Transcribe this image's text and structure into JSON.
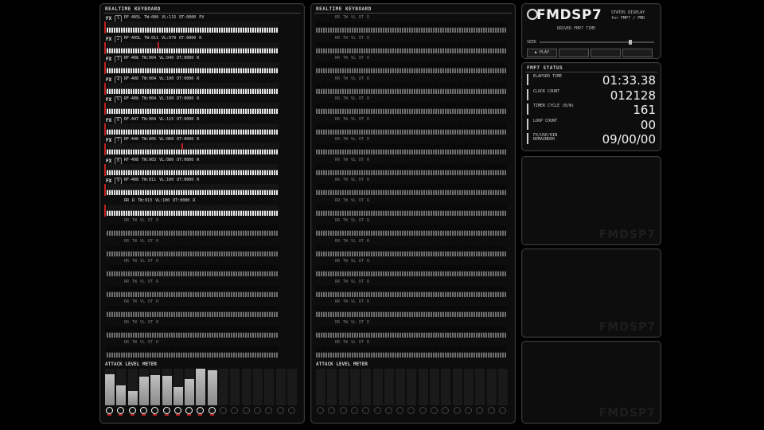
{
  "left_panel": {
    "header": "REALTIME KEYBOARD",
    "rows": [
      {
        "fx": "FX",
        "ch": "1",
        "info": "RF-405L TW:000 VL:115 DT:0000 PV",
        "active": true,
        "mark": false
      },
      {
        "fx": "FX",
        "ch": "2",
        "info": "RF-405L TW:011 VL:070 DT:0000 R",
        "active": true,
        "mark": true
      },
      {
        "fx": "FX",
        "ch": "3",
        "info": "RF-408 TW:004 VL:040 DT:0000 R",
        "active": true,
        "mark": false
      },
      {
        "fx": "FX",
        "ch": "4",
        "info": "RF-408 TW:004 VL:100 DT:0000 R",
        "active": true,
        "mark": false
      },
      {
        "fx": "FX",
        "ch": "5",
        "info": "RF-408 TW:004 VL:100 DT:0000 R",
        "active": true,
        "mark": false
      },
      {
        "fx": "FX",
        "ch": "6",
        "info": "RF-447 TW:004 VL:115 DT:0000 R",
        "active": true,
        "mark": false
      },
      {
        "fx": "FX",
        "ch": "7",
        "info": "RF-440 TW:005 VL:060 DT:0000 R",
        "active": true,
        "mark": true
      },
      {
        "fx": "FX",
        "ch": "8",
        "info": "RF-408 TW:003 VL:080 DT:0000 R",
        "active": true,
        "mark": false
      },
      {
        "fx": "FX",
        "ch": "9",
        "info": "RF-408 TW:011 VL:100 DT:0000 R",
        "active": true,
        "mark": false
      },
      {
        "fx": "",
        "ch": "",
        "info": "RR R TW:013 VL:100 DT:0000 R",
        "active": true,
        "mark": false
      },
      {
        "fx": "",
        "ch": "",
        "info": "RR TW VL DT R",
        "active": false,
        "mark": false
      },
      {
        "fx": "",
        "ch": "",
        "info": "RR TW VL DT R",
        "active": false,
        "mark": false
      },
      {
        "fx": "",
        "ch": "",
        "info": "RR TW VL DT R",
        "active": false,
        "mark": false
      },
      {
        "fx": "",
        "ch": "",
        "info": "RR TW VL DT R",
        "active": false,
        "mark": false
      },
      {
        "fx": "",
        "ch": "",
        "info": "RR TW VL DT R",
        "active": false,
        "mark": false
      },
      {
        "fx": "",
        "ch": "",
        "info": "RR TW VL DT R",
        "active": false,
        "mark": false
      },
      {
        "fx": "",
        "ch": "",
        "info": "RR TW VL DT R",
        "active": false,
        "mark": false
      }
    ],
    "meter_label": "ATTACK LEVEL METER",
    "meter_levels": [
      0.85,
      0.55,
      0.4,
      0.78,
      0.82,
      0.8,
      0.5,
      0.72,
      1.0,
      0.95,
      0,
      0,
      0,
      0,
      0,
      0,
      0
    ],
    "meter_active": [
      true,
      true,
      true,
      true,
      true,
      true,
      true,
      true,
      true,
      true,
      false,
      false,
      false,
      false,
      false,
      false,
      false
    ]
  },
  "right_panel": {
    "header": "REALTIME KEYBOARD",
    "row_info": "RR TW VL DT R",
    "row_count": 17,
    "meter_label": "ATTACK LEVEL METER"
  },
  "logo": {
    "title": "FMDSP7",
    "sub1": "STATUS DISPLAY",
    "sub2": "for FMP7 / PMD",
    "driver": "DRIVER FMP7 TIME",
    "seek_label": "SEEK",
    "tabs": [
      "▶ PLAY",
      "",
      "",
      ""
    ]
  },
  "status": {
    "header": "FMP7 STATUS",
    "items": [
      {
        "label": "ELAPSED TIME",
        "value": "01:33.38"
      },
      {
        "label": "CLOCK COUNT",
        "value": "012128"
      },
      {
        "label": "TIMER CYCLE (B/W)",
        "value": "161"
      },
      {
        "label": "LOOP COUNT",
        "value": "00"
      },
      {
        "label": "FX/USE/RIN REMAINDER",
        "value": "09/00/00"
      }
    ]
  },
  "info_panels": [
    {
      "watermark": "FMDSP7"
    },
    {
      "watermark": "FMDSP7"
    },
    {
      "watermark": "FMDSP7"
    }
  ],
  "colors": {
    "accent_red": "#c02020",
    "meter_grey": "#9a9a9a",
    "panel_bg": "#0d0d0d"
  }
}
